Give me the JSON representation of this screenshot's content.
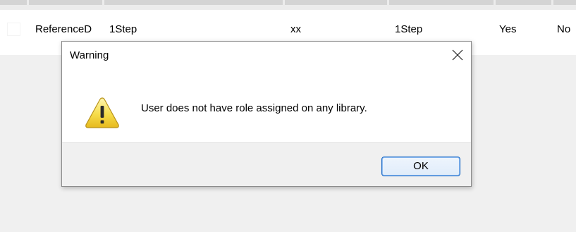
{
  "grid": {
    "row": {
      "cells": [
        "ReferenceD",
        "1Step",
        "xx",
        "1Step",
        "Yes",
        "No"
      ]
    }
  },
  "dialog": {
    "title": "Warning",
    "close_icon": "close-icon",
    "warning_icon": "warning-icon",
    "message": "User  does not have role assigned on any library.",
    "ok_label": "OK"
  },
  "colors": {
    "window_bg": "#f0f0f0",
    "dialog_bg": "#ffffff",
    "footer_bg": "#f0f0f0",
    "ok_border": "#1466c5",
    "warning_yellow": "#f2d23a"
  }
}
